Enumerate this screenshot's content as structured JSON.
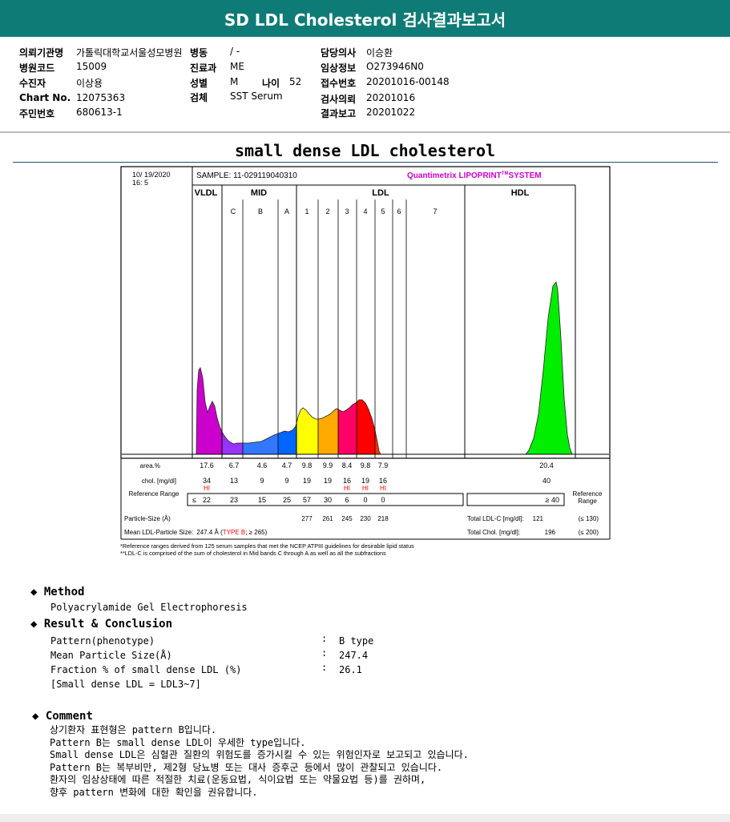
{
  "header": {
    "title": "SD LDL Cholesterol 검사결과보고서"
  },
  "info": {
    "institution": {
      "label": "의뢰기관명",
      "value": "가톨릭대학교서울성모병원"
    },
    "ward": {
      "label": "병동",
      "value": "/ -"
    },
    "doctor": {
      "label": "담당의사",
      "value": "이승환"
    },
    "hospital_code": {
      "label": "병원코드",
      "value": "15009"
    },
    "department": {
      "label": "진료과",
      "value": "ME"
    },
    "clinical_info": {
      "label": "임상정보",
      "value": "O273946N0"
    },
    "patient": {
      "label": "수진자",
      "value": "이상용"
    },
    "sex": {
      "label": "성별",
      "value": "M"
    },
    "age": {
      "label": "나이",
      "value": "52"
    },
    "receipt_no": {
      "label": "접수번호",
      "value": "20201016-00148"
    },
    "chart_no": {
      "label": "Chart No.",
      "value": "12075363"
    },
    "specimen": {
      "label": "검체",
      "value": "SST Serum"
    },
    "request_date": {
      "label": "검사의뢰",
      "value": "20201016"
    },
    "resident_no": {
      "label": "주민번호",
      "value": "680613-1"
    },
    "report_date": {
      "label": "결과보고",
      "value": "20201022"
    }
  },
  "report_title": "small dense LDL cholesterol",
  "chart_data": {
    "type": "area",
    "date": "10/ 19/2020",
    "time": "16: 5",
    "sample": "SAMPLE:  11-029119040310",
    "brand": "Quantimetrix LIPOPRINT",
    "brand_tm": "TM",
    "brand_suffix": "SYSTEM",
    "groups": [
      "VLDL",
      "MID",
      "LDL",
      "HDL"
    ],
    "bands": [
      "C",
      "B",
      "A",
      "1",
      "2",
      "3",
      "4",
      "5",
      "6",
      "7"
    ],
    "row_labels": {
      "area": "area.%",
      "chol": "chol. [mg/dl]",
      "ref": "Reference Range",
      "particle": "Particle-Size (Å)",
      "mean": "Mean LDL-Particle Size:"
    },
    "area": [
      "17.6",
      "6.7",
      "4.6",
      "4.7",
      "9.8",
      "9.9",
      "8.4",
      "9.8",
      "7.9",
      "20.4"
    ],
    "chol": [
      "34",
      "13",
      "9",
      "9",
      "19",
      "19",
      "16",
      "19",
      "16",
      "40"
    ],
    "hi_flag": "HI",
    "hi_indices": [
      0,
      6,
      7,
      8
    ],
    "ref_prefix": "≤",
    "ref": [
      "22",
      "23",
      "15",
      "25",
      "57",
      "30",
      "6",
      "0",
      "0"
    ],
    "hdl_ref": "≥ 40",
    "ref_right": "Reference Range",
    "particle_sizes": [
      "277",
      "261",
      "245",
      "230",
      "218"
    ],
    "mean_size_text": "247.4 Å (",
    "mean_type": "TYPE B",
    "mean_suffix": "; ≥ 265)",
    "total_ldl": {
      "label": "Total LDL-C [mg/dl]:",
      "value": "121",
      "ref": "(≤ 130)"
    },
    "total_chol": {
      "label": "Total Chol. [mg/dl]:",
      "value": "196",
      "ref": "(≤ 200)"
    },
    "footnote1": "*Reference ranges derived from 125 serum samples that met the NCEP ATPIII guidelines for desirable lipid status",
    "footnote2": "**LDL-C is comprised of the sum of cholesterol in Mid bands C through A as well as all the subfractions",
    "colors": {
      "vldl": "#cc00cc",
      "midc": "#9933ff",
      "midb": "#3377ff",
      "mida": "#0066ff",
      "ldl1": "#ffff00",
      "ldl2": "#ffaa00",
      "ldl3": "#ff0066",
      "ldl4": "#ff0000",
      "ldl5": "#ff3300",
      "hdl": "#00ee00",
      "brand": "#cc00cc",
      "hi": "#ff0000"
    }
  },
  "method": {
    "heading": "Method",
    "text": "Polyacrylamide Gel Electrophoresis"
  },
  "result": {
    "heading": "Result & Conclusion",
    "rows": [
      {
        "label": "Pattern(phenotype)",
        "value": "B type"
      },
      {
        "label": "Mean Particle Size(Å)",
        "value": "247.4"
      },
      {
        "label": "Fraction % of small dense LDL (%)",
        "value": "26.1"
      }
    ],
    "note": "[Small dense LDL = LDL3~7]",
    "colon": ":"
  },
  "comment": {
    "heading": "Comment",
    "lines": [
      "상기환자 표현형은 pattern B입니다.",
      "Pattern B는 small dense LDL이 우세한 type입니다.",
      "Small dense LDL은 심혈관 질환의 위험도를 증가시킬 수 있는 위험인자로 보고되고 있습니다.",
      "Pattern B는 복부비만, 제2형 당뇨병 또는 대사 증후군 등에서 많이 관찰되고 있습니다.",
      "환자의 임상상태에 따른 적절한 치료(운동요법, 식이요법 또는 약물요법 등)를 권하며,",
      "향후 pattern 변화에 대한 확인을 권유합니다."
    ]
  },
  "icons": {
    "bullet": "diamond-bullet-icon"
  }
}
